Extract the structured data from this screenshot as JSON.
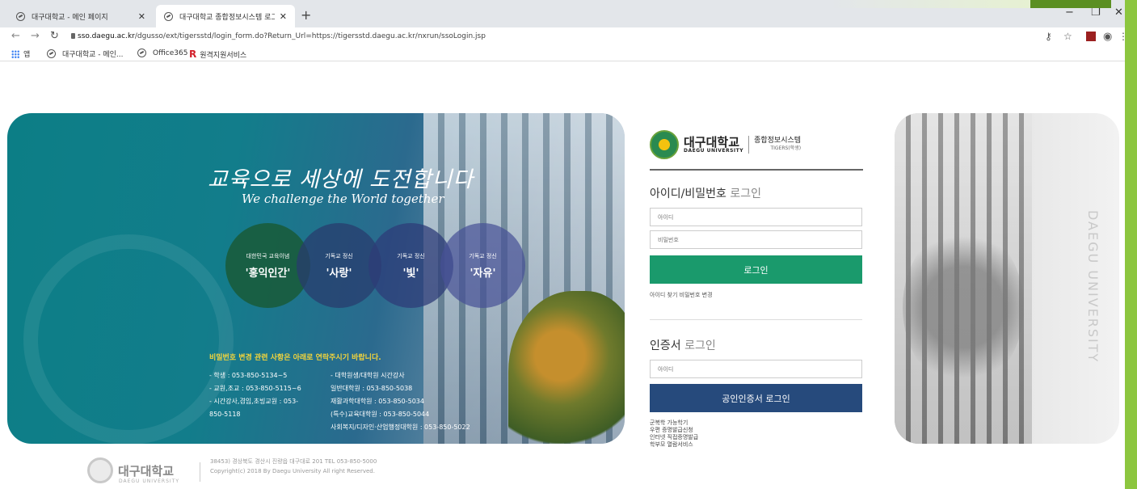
{
  "browser": {
    "tabs": [
      {
        "title": "대구대학교 - 메인 페이지",
        "active": false
      },
      {
        "title": "대구대학교 종합정보시스템 로그...",
        "active": true
      }
    ],
    "url_host": "sso.daegu.ac.kr",
    "url_path": "/dgusso/ext/tigersstd/login_form.do?Return_Url=https://tigersstd.daegu.ac.kr/nxrun/ssoLogin.jsp",
    "bookmarks": {
      "apps": "앱",
      "items": [
        "대구대학교 - 메인...",
        "Office365",
        "원격지원서비스"
      ]
    }
  },
  "hero": {
    "slogan_ko": "교육으로 세상에 도전합니다",
    "slogan_en": "We challenge the World together",
    "circles": [
      {
        "sub": "대한민국 교육이념",
        "main": "'홍익인간'"
      },
      {
        "sub": "기독교 정신",
        "main": "'사랑'"
      },
      {
        "sub": "기독교 정신",
        "main": "'빛'"
      },
      {
        "sub": "기독교 정신",
        "main": "'자유'"
      }
    ],
    "contact_title": "비밀번호 변경 관련 사항은 아래로 연락주시기 바랍니다.",
    "contact_left": [
      "- 학생 : 053-850-5134~5",
      "- 교원,조교 : 053-850-5115~6",
      "- 시간강사,겸임,초빙교원 : 053-",
      "850-5118"
    ],
    "contact_right": [
      "- 대학원생/대학원 시간강사",
      "  일반대학원 : 053-850-5038",
      "  재활과학대학원 : 053-850-5034",
      "  (특수)교육대학원 : 053-850-5044",
      "  사회복지/디자인·산업행정대학원 : 053-850-5022"
    ]
  },
  "footer": {
    "name": "대구대학교",
    "name_en": "DAEGU UNIVERSITY",
    "address": "38453) 경상북도 경산시 진량읍 대구대로 201 TEL 053-850-5000",
    "copyright": "Copyright(c) 2018 By Daegu University All right Reserved."
  },
  "login": {
    "logo_ko": "대구대학교",
    "logo_en": "DAEGU UNIVERSITY",
    "logo_system": "종합정보시스템",
    "logo_system_sub": "TIGERS(학생)",
    "id_pw_title_bold": "아이디/비밀번호",
    "id_pw_title_light": "로그인",
    "id_placeholder": "아이디",
    "pw_placeholder": "비밀번호",
    "login_button": "로그인",
    "find_links": "아이디 찾기 비밀번호 변경",
    "cert_title_bold": "인증서",
    "cert_title_light": "로그인",
    "cert_id_placeholder": "아이디",
    "cert_button": "공인인증서 로그인",
    "cert_links": [
      "군복학 가능학기",
      "우편 증명발급신청",
      "인터넷 직접증명발급",
      "학부모 열람서비스"
    ]
  },
  "side": {
    "vertical_text": "DAEGU UNIVERSITY"
  },
  "colors": {
    "login_green": "#1a9a6c",
    "cert_navy": "#264a7c",
    "edge_green": "#8cc63f"
  }
}
